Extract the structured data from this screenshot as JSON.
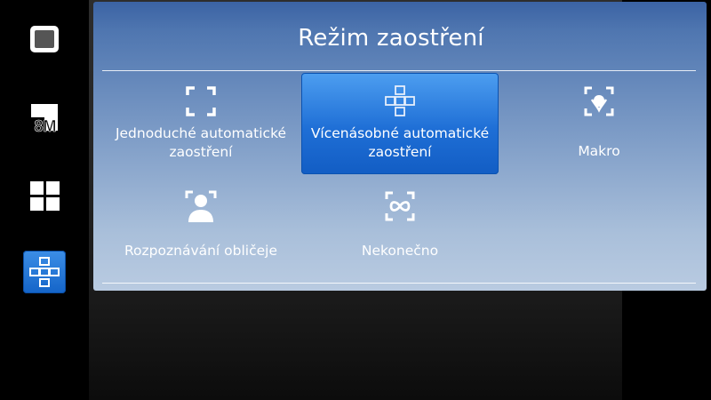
{
  "dialog": {
    "title": "Režim zaostření"
  },
  "sidebar": {
    "items": [
      {
        "icon": "screen-icon"
      },
      {
        "icon": "resolution-icon",
        "label": "8M"
      },
      {
        "icon": "grid-icon"
      },
      {
        "icon": "multi-focus-icon",
        "active": true
      }
    ]
  },
  "options": [
    {
      "label": "Jednoduché automatické zaostření",
      "icon": "single-af-icon",
      "selected": false
    },
    {
      "label": "Vícenásobné automatické zaostření",
      "icon": "multi-af-icon",
      "selected": true
    },
    {
      "label": "Makro",
      "icon": "macro-icon",
      "selected": false
    },
    {
      "label": "Rozpoznávání obličeje",
      "icon": "face-detection-icon",
      "selected": false
    },
    {
      "label": "Nekonečno",
      "icon": "infinity-icon",
      "selected": false
    }
  ],
  "colors": {
    "selected": "#1f6fd6",
    "panel_top": "#3b63a4",
    "panel_bottom": "#b9cbe1"
  }
}
